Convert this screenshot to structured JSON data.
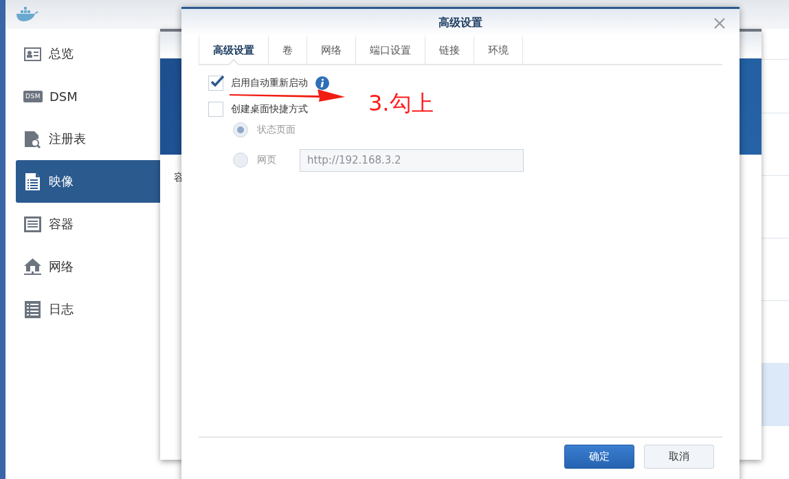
{
  "app": {
    "sidebar": [
      {
        "label": "总览",
        "selected": false
      },
      {
        "label": "DSM",
        "badge_text": "DSM",
        "selected": false
      },
      {
        "label": "注册表",
        "selected": false
      },
      {
        "label": "映像",
        "selected": true
      },
      {
        "label": "容器",
        "selected": false
      },
      {
        "label": "网络",
        "selected": false
      },
      {
        "label": "日志",
        "selected": false
      }
    ]
  },
  "background_window": {
    "label": "容"
  },
  "dialog": {
    "title": "高级设置",
    "tabs": [
      {
        "label": "高级设置",
        "selected": true
      },
      {
        "label": "卷",
        "selected": false
      },
      {
        "label": "网络",
        "selected": false
      },
      {
        "label": "端口设置",
        "selected": false
      },
      {
        "label": "链接",
        "selected": false
      },
      {
        "label": "环境",
        "selected": false
      }
    ],
    "options": [
      {
        "label": "启用自动重新启动",
        "checked": true,
        "info": true
      },
      {
        "label": "创建桌面快捷方式",
        "checked": false,
        "info": false
      }
    ],
    "radios": [
      {
        "label": "状态页面",
        "selected": true,
        "disabled": true
      },
      {
        "label": "网页",
        "selected": false,
        "disabled": true,
        "value": "http://192.168.3.2"
      }
    ],
    "buttons": [
      {
        "label": "确定",
        "kind": "primary"
      },
      {
        "label": "取消",
        "kind": "secondary"
      }
    ]
  },
  "annotation": {
    "text": "3.勾上"
  }
}
